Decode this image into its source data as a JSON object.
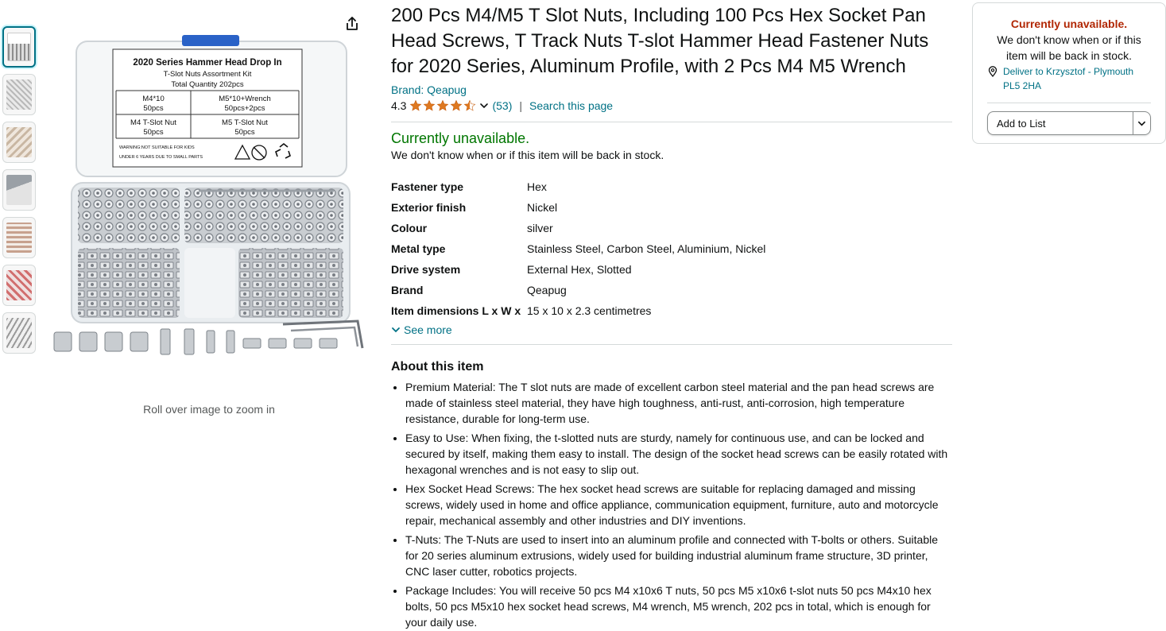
{
  "product": {
    "title": "200 Pcs M4/M5 T Slot Nuts, Including 100 Pcs Hex Socket Pan Head Screws, T Track Nuts T-slot Hammer Head Fastener Nuts for 2020 Series, Aluminum Profile, with 2 Pcs M4 M5 Wrench",
    "brand_link": "Brand: Qeapug",
    "rating": "4.3",
    "stars_value": 4.3,
    "ratings_count": "(53)",
    "search_link": "Search this page",
    "separator": "|"
  },
  "image": {
    "roll_over_text": "Roll over image to zoom in",
    "box_label": {
      "line1": "2020 Series Hammer Head Drop In",
      "line2": "T-Slot Nuts Assortment Kit",
      "line3": "Total Quantity 202pcs",
      "cell1a": "M4*10",
      "cell1b": "50pcs",
      "cell2a": "M5*10+Wrench",
      "cell2b": "50pcs+2pcs",
      "cell3a": "M4 T-Slot Nut",
      "cell3b": "50pcs",
      "cell4a": "M5 T-Slot Nut",
      "cell4b": "50pcs",
      "warn1": "WARNING:NOT SUITABLE FOR KIDS",
      "warn2": "UNDER 6 YEARS DUE TO SMALL PARTS"
    },
    "thumbnail_count": 7
  },
  "availability": {
    "status": "Currently unavailable.",
    "detail": "We don't know when or if this item will be back in stock."
  },
  "specs": [
    {
      "key": "Fastener type",
      "value": "Hex"
    },
    {
      "key": "Exterior finish",
      "value": "Nickel"
    },
    {
      "key": "Colour",
      "value": "silver"
    },
    {
      "key": "Metal type",
      "value": "Stainless Steel, Carbon Steel, Aluminium, Nickel"
    },
    {
      "key": "Drive system",
      "value": "External Hex, Slotted"
    },
    {
      "key": "Brand",
      "value": "Qeapug"
    },
    {
      "key": "Item dimensions L x W x",
      "value": "15 x 10 x 2.3 centimetres"
    }
  ],
  "see_more": "See more",
  "about": {
    "heading": "About this item",
    "bullets": [
      "Premium Material: The T slot nuts are made of excellent carbon steel material and the pan head screws are made of stainless steel material, they have high toughness, anti-rust, anti-corrosion, high temperature resistance, durable for long-term use.",
      "Easy to Use: When fixing, the t-slotted nuts are sturdy, namely for continuous use, and can be locked and secured by itself, making them easy to install. The design of the socket head screws can be easily rotated with hexagonal wrenches and is not easy to slip out.",
      "Hex Socket Head Screws: The hex socket head screws are suitable for replacing damaged and missing screws, widely used in home and office appliance, communication equipment, furniture, auto and motorcycle repair, mechanical assembly and other industries and DIY inventions.",
      "T-Nuts: The T-Nuts are used to insert into an aluminum profile and connected with T-bolts or others. Suitable for 20 series aluminum extrusions, widely used for building industrial aluminum frame structure, 3D printer, CNC laser cutter, robotics projects.",
      "Package Includes: You will receive 50 pcs M4 x10x6 T nuts, 50 pcs M5 x10x6 t-slot nuts 50 pcs M4x10 hex bolts, 50 pcs M5x10 hex socket head screws, M4 wrench, M5 wrench, 202 pcs in total, which is enough for your daily use."
    ]
  },
  "buybox": {
    "title": "Currently unavailable.",
    "detail": "We don't know when or if this item will be back in stock.",
    "deliver": "Deliver to Krzysztof - Plymouth PL5 2HA",
    "add_to_list": "Add to List"
  },
  "colors": {
    "link": "#007185",
    "available_green": "#007600",
    "unavailable_red": "#b12704",
    "star_orange": "#de7921",
    "active_thumb": "#007185"
  }
}
